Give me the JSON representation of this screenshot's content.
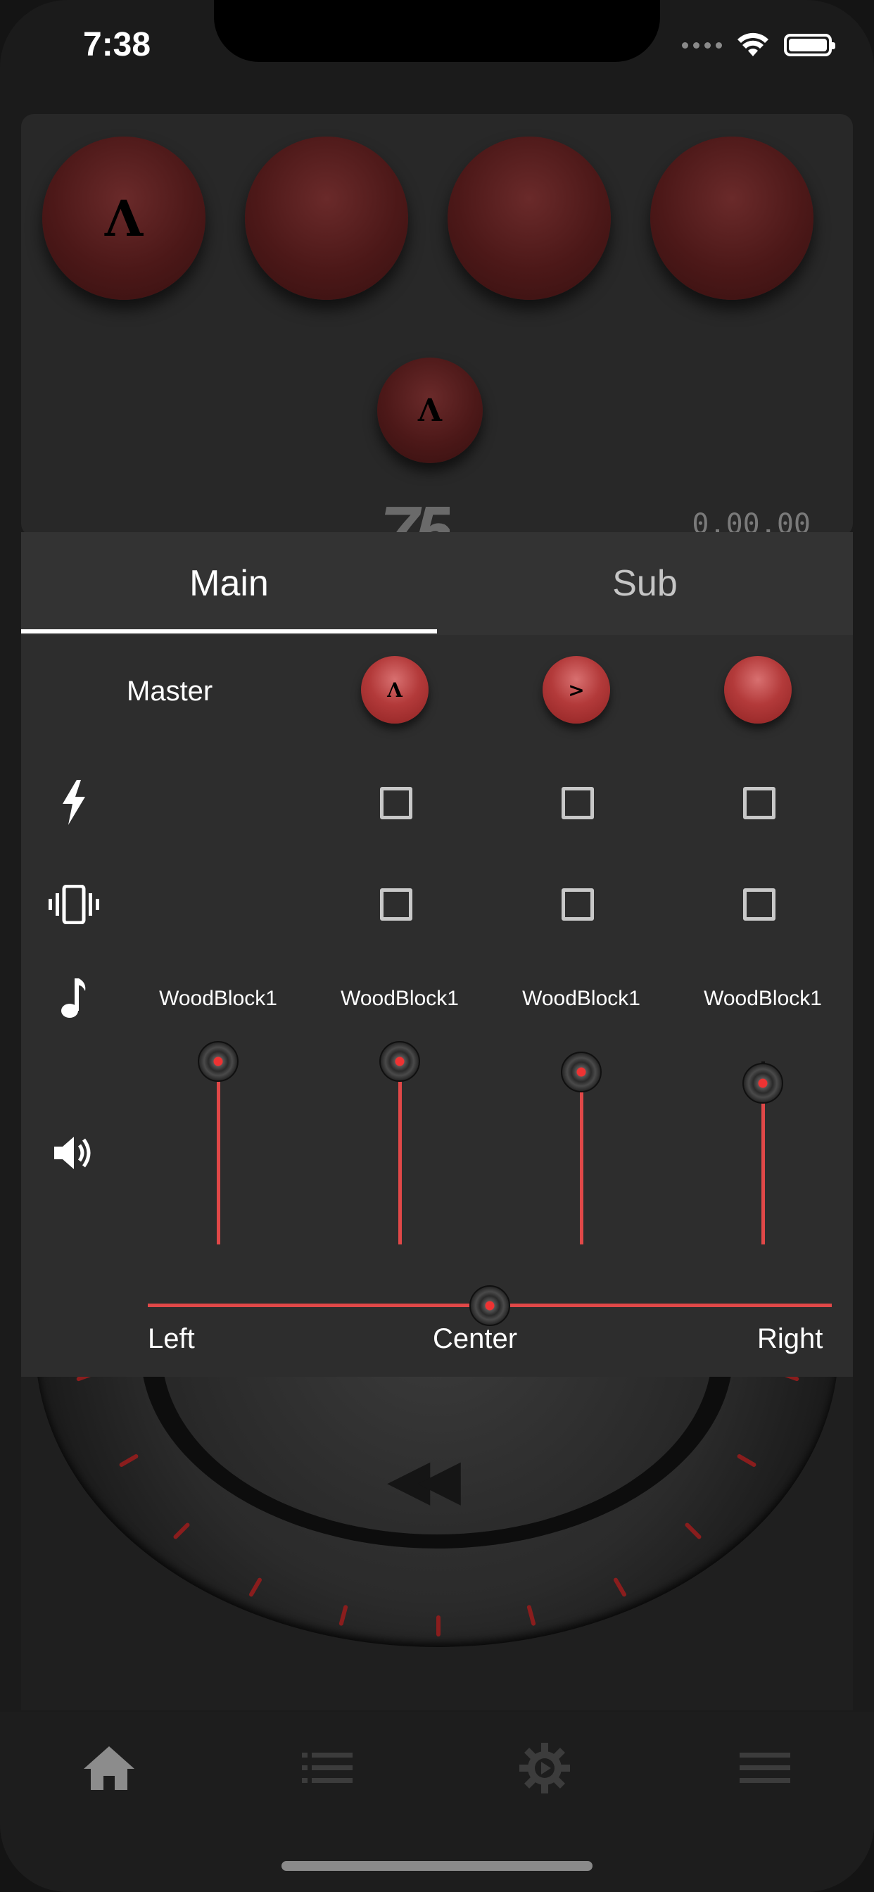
{
  "status_bar": {
    "time": "7:38"
  },
  "pads": {
    "pad1_symbol": "Λ",
    "center_symbol": "Λ"
  },
  "header_readout": {
    "tempo_fragment": "75",
    "timer": "0.00.00"
  },
  "tabs": [
    {
      "label": "Main",
      "selected": true
    },
    {
      "label": "Sub",
      "selected": false
    }
  ],
  "mixer": {
    "master_label": "Master",
    "mini_pads": [
      {
        "symbol": "Λ"
      },
      {
        "symbol": ">"
      },
      {
        "symbol": ""
      }
    ],
    "row_icons": [
      "flash-icon",
      "vibrate-icon",
      "music-note-icon",
      "volume-icon"
    ],
    "flash_checks": [
      false,
      false,
      false
    ],
    "vibrate_checks": [
      false,
      false,
      false
    ],
    "sounds": [
      "WoodBlock1",
      "WoodBlock1",
      "WoodBlock1",
      "WoodBlock1"
    ],
    "volumes": [
      1.0,
      1.0,
      0.91,
      0.82
    ],
    "pan": {
      "left_label": "Left",
      "center_label": "Center",
      "right_label": "Right",
      "value": 0.5
    }
  },
  "bottom_nav": [
    {
      "icon": "home-icon",
      "active": true
    },
    {
      "icon": "list-icon",
      "active": false
    },
    {
      "icon": "gear-play-icon",
      "active": false
    },
    {
      "icon": "menu-icon",
      "active": false
    }
  ],
  "colors": {
    "accent": "#e04848",
    "pad": "#4c1818",
    "panel": "#2d2d2d"
  }
}
